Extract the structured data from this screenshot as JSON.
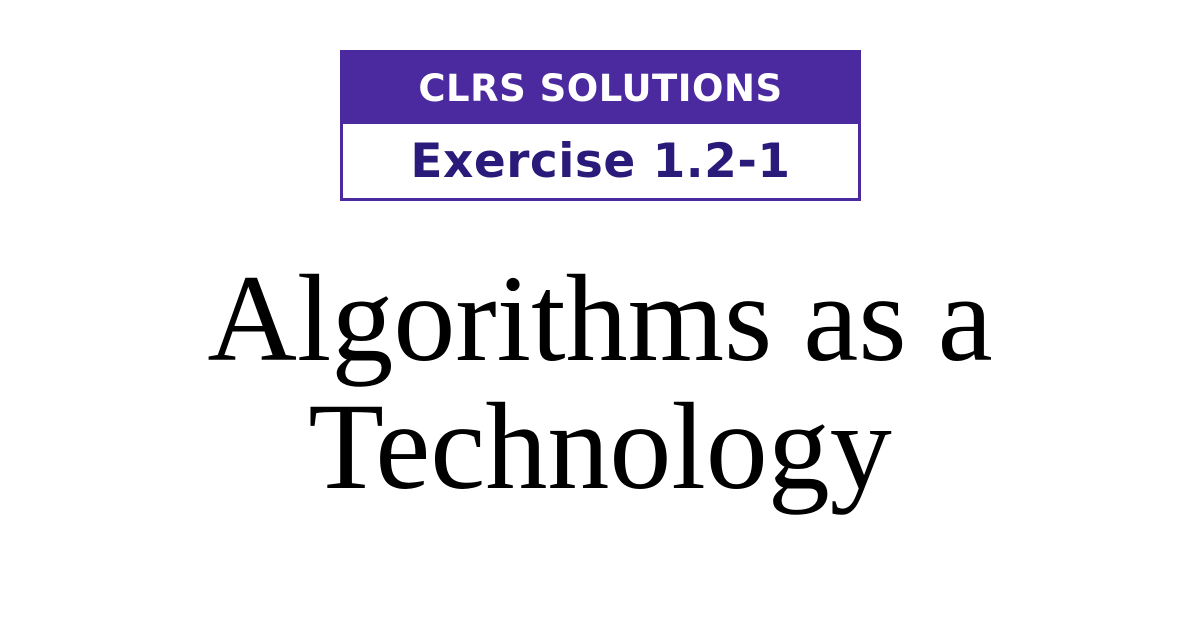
{
  "badge": {
    "top_text": "CLRS SOLUTIONS",
    "bottom_text": "Exercise 1.2-1"
  },
  "title": {
    "line1": "Algorithms as a",
    "line2": "Technology"
  },
  "colors": {
    "brand_purple": "#4a2a9e",
    "exercise_text": "#2a1b7a",
    "title_text": "#000000"
  }
}
